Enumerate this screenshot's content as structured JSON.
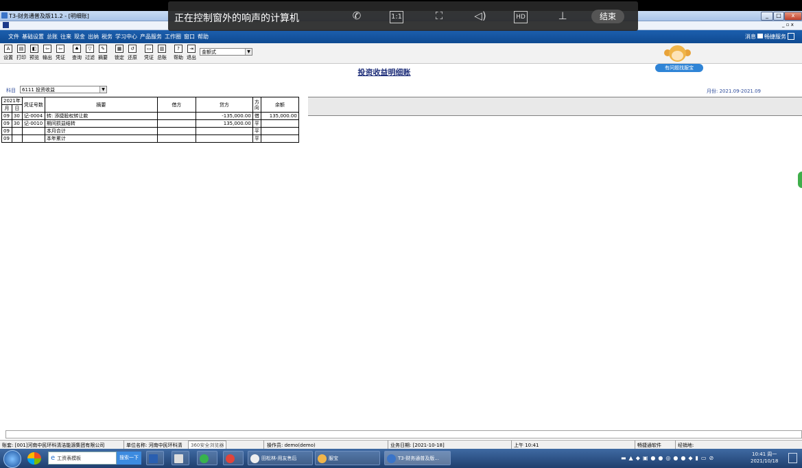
{
  "app": {
    "window_title": "T3-财务通普及版11.2 - [明细账]",
    "menu": [
      "文件",
      "基础设置",
      "总账",
      "往来",
      "现金",
      "出纳",
      "税务",
      "学习中心",
      "产品服务",
      "工作圈",
      "窗口",
      "帮助"
    ],
    "right_links": [
      "消息",
      "畅捷服务"
    ]
  },
  "toolbar": {
    "buttons": [
      "设置",
      "打印",
      "预览",
      "输出",
      "凭证",
      "查询",
      "过滤",
      "摘要",
      "锁定",
      "还原",
      "凭证",
      "总账",
      "帮助",
      "退出"
    ],
    "format_select": "金额式"
  },
  "mascot": {
    "label": "有问题找服宝"
  },
  "page": {
    "title": "投资收益明细账",
    "subject_label": "科目",
    "subject_value": "6111 投资收益",
    "month_range": "月份: 2021.09-2021.09"
  },
  "table": {
    "year": "2021年",
    "col_month": "月",
    "col_day": "日",
    "col_voucher": "凭证号数",
    "col_summary": "摘要",
    "col_debit": "借方",
    "col_credit": "贷方",
    "col_direction": "方向",
    "col_balance": "余额",
    "rows": [
      {
        "m": "09",
        "d": "30",
        "v": "记-0004",
        "s": "转: 添捷股权转让款",
        "dr": "",
        "cr": "-135,000.00",
        "dir": "借",
        "bal": "135,000.00"
      },
      {
        "m": "09",
        "d": "30",
        "v": "记-0010",
        "s": "期间损益结转",
        "dr": "",
        "cr": "135,000.00",
        "dir": "平",
        "bal": ""
      },
      {
        "m": "09",
        "d": "",
        "v": "",
        "s": "本月合计",
        "dr": "",
        "cr": "",
        "dir": "平",
        "bal": ""
      },
      {
        "m": "09",
        "d": "",
        "v": "",
        "s": "本年累计",
        "dr": "",
        "cr": "",
        "dir": "平",
        "bal": ""
      }
    ]
  },
  "status": {
    "account": "账套: [001]河南中民环科清洁能源集团有限公司",
    "unit": "单位名称: 河南中民环科清",
    "browser_tag": "360安全浏览器",
    "operator": "操作员: demo(demo)",
    "biz_date": "业务日期: [2021-10-18]",
    "time": "上午 10:41",
    "software": "畅捷通软件",
    "dealer": "经销地:"
  },
  "overlay": {
    "message": "正在控制窗外的响声的计算机",
    "end_label": "结束",
    "ratio_label": "1:1",
    "hd_label": "HD"
  },
  "taskbar": {
    "search_box": "工资表模板",
    "search_btn": "搜索一下",
    "tasks": [
      "田松林-用友售后",
      "服宝",
      "T3-财务通普及版..."
    ],
    "clock_time": "10:41 周一",
    "clock_date": "2021/10/18"
  }
}
